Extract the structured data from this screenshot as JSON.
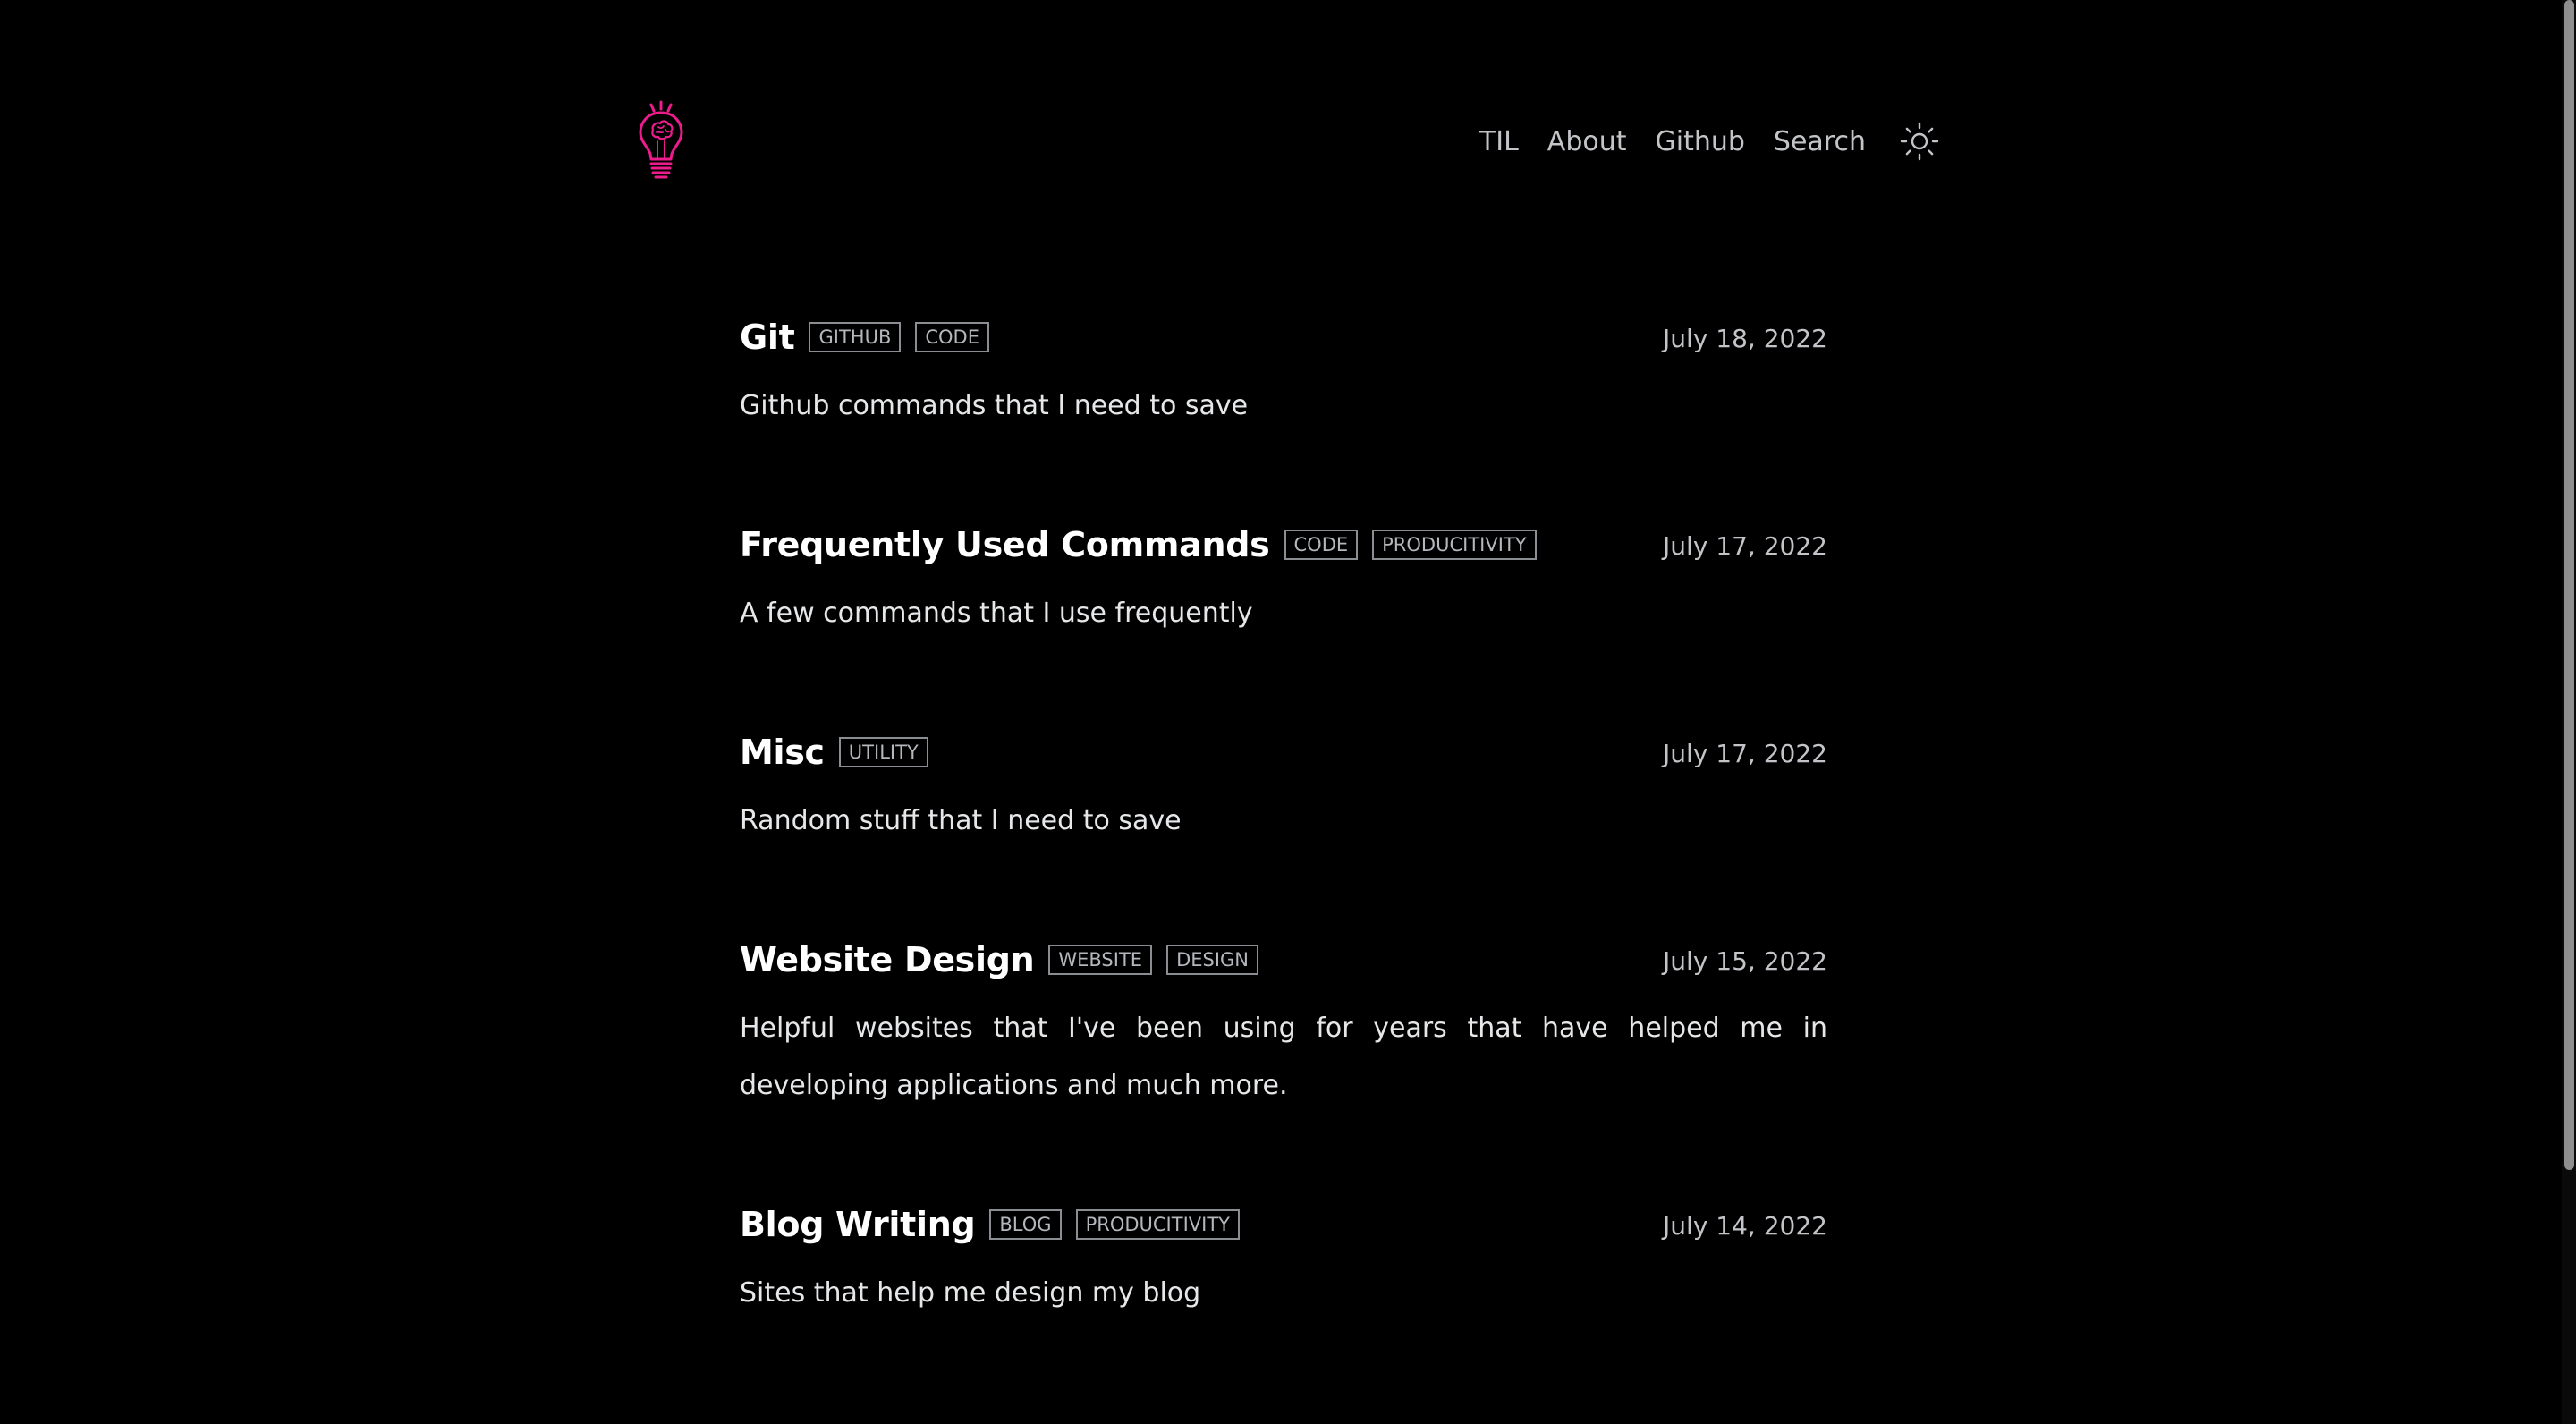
{
  "header": {
    "logo_icon": "lightbulb-brain-icon",
    "accent_color": "#ec1c8c",
    "nav": [
      {
        "label": "TIL"
      },
      {
        "label": "About"
      },
      {
        "label": "Github"
      },
      {
        "label": "Search"
      }
    ],
    "theme_toggle_icon": "sun-icon"
  },
  "posts": [
    {
      "title": "Git",
      "tags": [
        "GITHUB",
        "CODE"
      ],
      "date": "July 18, 2022",
      "description": "Github commands that I need to save"
    },
    {
      "title": "Frequently Used Commands",
      "tags": [
        "CODE",
        "PRODUCITIVITY"
      ],
      "date": "July 17, 2022",
      "description": "A few commands that I use frequently"
    },
    {
      "title": "Misc",
      "tags": [
        "UTILITY"
      ],
      "date": "July 17, 2022",
      "description": "Random stuff that I need to save"
    },
    {
      "title": "Website Design",
      "tags": [
        "WEBSITE",
        "DESIGN"
      ],
      "date": "July 15, 2022",
      "description": "Helpful websites that I've been using for years that have helped me in developing applications and much more."
    },
    {
      "title": "Blog Writing",
      "tags": [
        "BLOG",
        "PRODUCITIVITY"
      ],
      "date": "July 14, 2022",
      "description": "Sites that help me design my blog"
    }
  ],
  "colors": {
    "background": "#000000",
    "text": "#e6e7e9",
    "muted": "#c2c4c8",
    "tag_border": "#8a8d92"
  }
}
